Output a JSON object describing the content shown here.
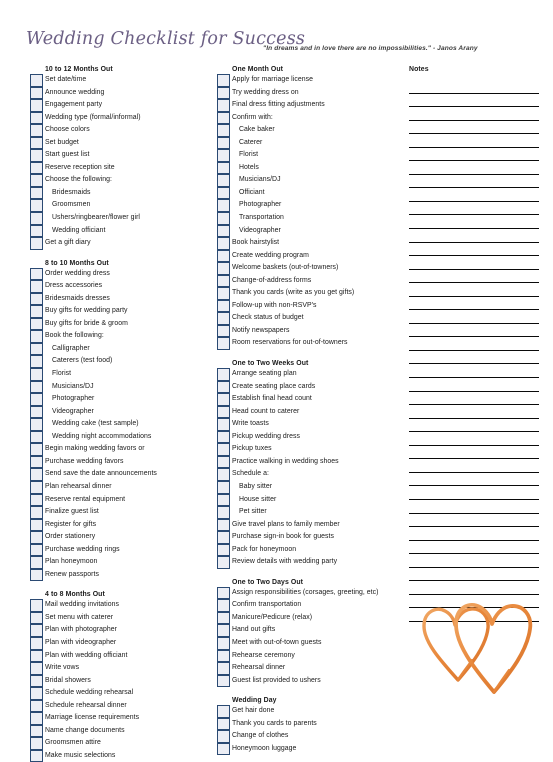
{
  "header": {
    "title": "Wedding Checklist for Success",
    "quote": "\"In dreams and in love there are no impossibilities.\" - Janos Arany",
    "title_color": "#6b5f84"
  },
  "notes": {
    "title": "Notes",
    "line_count": 40
  },
  "graphic": {
    "name": "two-interlocking-hearts",
    "color": "#e8883c"
  },
  "columns": [
    {
      "name": "column-1",
      "sections": [
        {
          "title": "10 to 12 Months Out",
          "items": [
            {
              "label": "Set date/time",
              "sub": false
            },
            {
              "label": "Announce wedding",
              "sub": false
            },
            {
              "label": "Engagement party",
              "sub": false
            },
            {
              "label": "Wedding type (formal/informal)",
              "sub": false
            },
            {
              "label": "Choose colors",
              "sub": false
            },
            {
              "label": "Set budget",
              "sub": false
            },
            {
              "label": "Start guest list",
              "sub": false
            },
            {
              "label": "Reserve reception site",
              "sub": false
            },
            {
              "label": "Choose the following:",
              "sub": false
            },
            {
              "label": "Bridesmaids",
              "sub": true
            },
            {
              "label": "Groomsmen",
              "sub": true
            },
            {
              "label": "Ushers/ringbearer/flower girl",
              "sub": true
            },
            {
              "label": "Wedding officiant",
              "sub": true
            },
            {
              "label": "Get a gift diary",
              "sub": false
            }
          ]
        },
        {
          "title": "8 to 10 Months Out",
          "items": [
            {
              "label": "Order wedding dress",
              "sub": false
            },
            {
              "label": "Dress accessories",
              "sub": false
            },
            {
              "label": "Bridesmaids dresses",
              "sub": false
            },
            {
              "label": "Buy gifts for wedding party",
              "sub": false
            },
            {
              "label": "Buy gifts for bride & groom",
              "sub": false
            },
            {
              "label": "Book the following:",
              "sub": false
            },
            {
              "label": "Calligrapher",
              "sub": true
            },
            {
              "label": "Caterers (test food)",
              "sub": true
            },
            {
              "label": "Florist",
              "sub": true
            },
            {
              "label": "Musicians/DJ",
              "sub": true
            },
            {
              "label": "Photographer",
              "sub": true
            },
            {
              "label": "Videographer",
              "sub": true
            },
            {
              "label": "Wedding cake (test sample)",
              "sub": true
            },
            {
              "label": "Wedding night accommodations",
              "sub": true
            },
            {
              "label": "Begin making wedding favors or",
              "sub": false
            },
            {
              "label": "Purchase wedding favors",
              "sub": false
            },
            {
              "label": "Send save the date announcements",
              "sub": false
            },
            {
              "label": "Plan rehearsal dinner",
              "sub": false
            },
            {
              "label": "Reserve rental equipment",
              "sub": false
            },
            {
              "label": "Finalize guest list",
              "sub": false
            },
            {
              "label": "Register for gifts",
              "sub": false
            },
            {
              "label": "Order stationery",
              "sub": false
            },
            {
              "label": "Purchase wedding rings",
              "sub": false
            },
            {
              "label": "Plan honeymoon",
              "sub": false
            },
            {
              "label": "Renew passports",
              "sub": false
            }
          ]
        },
        {
          "title": "4 to 8 Months Out",
          "items": [
            {
              "label": "Mail wedding invitations",
              "sub": false
            },
            {
              "label": "Set menu with caterer",
              "sub": false
            },
            {
              "label": "Plan with photographer",
              "sub": false
            },
            {
              "label": "Plan with videographer",
              "sub": false
            },
            {
              "label": "Plan with wedding officiant",
              "sub": false
            },
            {
              "label": "Write vows",
              "sub": false
            },
            {
              "label": "Bridal showers",
              "sub": false
            },
            {
              "label": "Schedule wedding rehearsal",
              "sub": false
            },
            {
              "label": "Schedule rehearsal dinner",
              "sub": false
            },
            {
              "label": "Marriage license requirements",
              "sub": false
            },
            {
              "label": "Name change documents",
              "sub": false
            },
            {
              "label": "Groomsmen attire",
              "sub": false
            },
            {
              "label": "Make music selections",
              "sub": false
            }
          ]
        }
      ]
    },
    {
      "name": "column-2",
      "sections": [
        {
          "title": "One Month Out",
          "items": [
            {
              "label": "Apply for marriage license",
              "sub": false
            },
            {
              "label": "Try wedding dress on",
              "sub": false
            },
            {
              "label": "Final dress fitting adjustments",
              "sub": false
            },
            {
              "label": "Confirm with:",
              "sub": false
            },
            {
              "label": "Cake baker",
              "sub": true
            },
            {
              "label": "Caterer",
              "sub": true
            },
            {
              "label": "Florist",
              "sub": true
            },
            {
              "label": "Hotels",
              "sub": true
            },
            {
              "label": "Musicians/DJ",
              "sub": true
            },
            {
              "label": "Officiant",
              "sub": true
            },
            {
              "label": "Photographer",
              "sub": true
            },
            {
              "label": "Transportation",
              "sub": true
            },
            {
              "label": "Videographer",
              "sub": true
            },
            {
              "label": "Book hairstylist",
              "sub": false
            },
            {
              "label": "Create wedding program",
              "sub": false
            },
            {
              "label": "Welcome baskets (out-of-towners)",
              "sub": false
            },
            {
              "label": "Change-of-address forms",
              "sub": false
            },
            {
              "label": "Thank you cards (write as you get gifts)",
              "sub": false
            },
            {
              "label": "Follow-up with non-RSVP's",
              "sub": false
            },
            {
              "label": "Check status of budget",
              "sub": false
            },
            {
              "label": "Notify newspapers",
              "sub": false
            },
            {
              "label": "Room reservations for out-of-towners",
              "sub": false
            }
          ]
        },
        {
          "title": "One to Two Weeks Out",
          "items": [
            {
              "label": "Arrange seating plan",
              "sub": false
            },
            {
              "label": "Create seating place cards",
              "sub": false
            },
            {
              "label": "Establish final head count",
              "sub": false
            },
            {
              "label": "Head count to caterer",
              "sub": false
            },
            {
              "label": "Write toasts",
              "sub": false
            },
            {
              "label": "Pickup wedding dress",
              "sub": false
            },
            {
              "label": "Pickup tuxes",
              "sub": false
            },
            {
              "label": "Practice walking in wedding shoes",
              "sub": false
            },
            {
              "label": "Schedule a:",
              "sub": false
            },
            {
              "label": "Baby sitter",
              "sub": true
            },
            {
              "label": "House sitter",
              "sub": true
            },
            {
              "label": "Pet sitter",
              "sub": true
            },
            {
              "label": "Give travel plans to family member",
              "sub": false
            },
            {
              "label": "Purchase sign-in book for guests",
              "sub": false
            },
            {
              "label": "Pack for honeymoon",
              "sub": false
            },
            {
              "label": "Review details with wedding party",
              "sub": false
            }
          ]
        },
        {
          "title": "One to Two Days Out",
          "items": [
            {
              "label": "Assign responsibilities (corsages, greeting, etc)",
              "sub": false
            },
            {
              "label": "Confirm transportation",
              "sub": false
            },
            {
              "label": "Manicure/Pedicure (relax)",
              "sub": false
            },
            {
              "label": "Hand out gifts",
              "sub": false
            },
            {
              "label": "Meet with out-of-town guests",
              "sub": false
            },
            {
              "label": "Rehearse ceremony",
              "sub": false
            },
            {
              "label": "Rehearsal dinner",
              "sub": false
            },
            {
              "label": "Guest list provided to ushers",
              "sub": false
            }
          ]
        },
        {
          "title": "Wedding Day",
          "items": [
            {
              "label": "Get hair done",
              "sub": false
            },
            {
              "label": "Thank you cards to parents",
              "sub": false
            },
            {
              "label": "Change of clothes",
              "sub": false
            },
            {
              "label": "Honeymoon luggage",
              "sub": false
            }
          ]
        }
      ]
    }
  ]
}
